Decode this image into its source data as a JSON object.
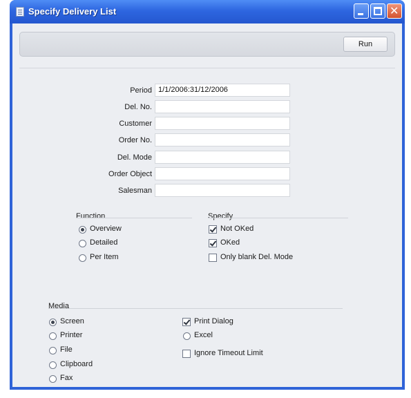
{
  "window": {
    "title": "Specify Delivery List"
  },
  "toolbar": {
    "run_label": "Run"
  },
  "fields": [
    {
      "label": "Period",
      "value": "1/1/2006:31/12/2006"
    },
    {
      "label": "Del. No.",
      "value": ""
    },
    {
      "label": "Customer",
      "value": ""
    },
    {
      "label": "Order No.",
      "value": ""
    },
    {
      "label": "Del. Mode",
      "value": ""
    },
    {
      "label": "Order Object",
      "value": ""
    },
    {
      "label": "Salesman",
      "value": ""
    }
  ],
  "function": {
    "title": "Function",
    "options": [
      {
        "label": "Overview",
        "selected": true
      },
      {
        "label": "Detailed",
        "selected": false
      },
      {
        "label": "Per Item",
        "selected": false
      }
    ]
  },
  "specify": {
    "title": "Specify",
    "options": [
      {
        "label": "Not OKed",
        "checked": true
      },
      {
        "label": "OKed",
        "checked": true
      },
      {
        "label": "Only blank Del. Mode",
        "checked": false
      }
    ]
  },
  "media": {
    "title": "Media",
    "options": [
      {
        "label": "Screen",
        "selected": true
      },
      {
        "label": "Printer",
        "selected": false
      },
      {
        "label": "File",
        "selected": false
      },
      {
        "label": "Clipboard",
        "selected": false
      },
      {
        "label": "Fax",
        "selected": false
      }
    ],
    "print_dialog": {
      "label": "Print Dialog",
      "checked": true
    },
    "excel": {
      "label": "Excel",
      "selected": false
    },
    "ignore_timeout": {
      "label": "Ignore Timeout Limit",
      "checked": false
    }
  }
}
